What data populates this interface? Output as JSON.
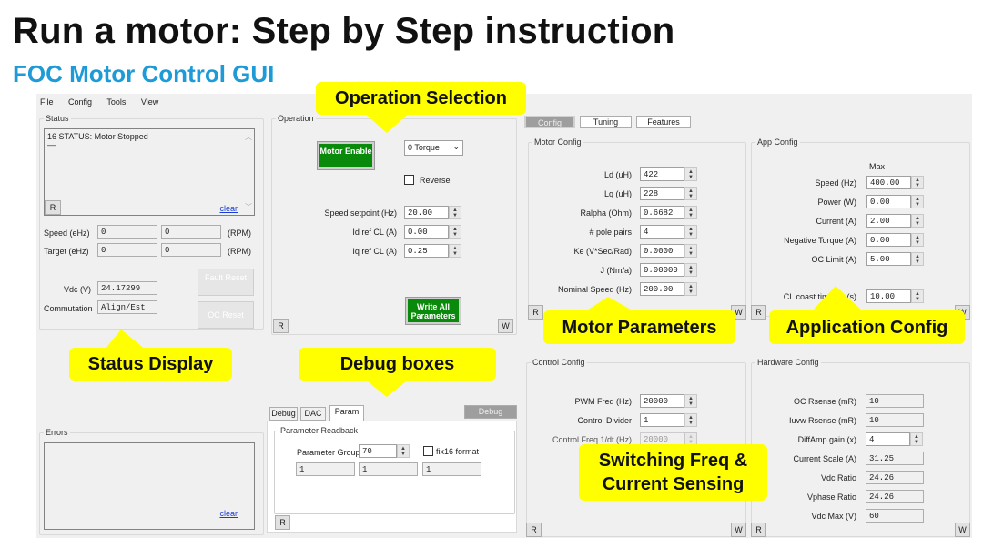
{
  "title": "Run a motor: Step by Step instruction",
  "subtitle": "FOC Motor Control GUI",
  "menu": [
    "File",
    "Config",
    "Tools",
    "View"
  ],
  "status": {
    "group": "Status",
    "log": "16 STATUS: Motor Stopped",
    "log2": "—",
    "clear": "clear",
    "r": "R",
    "speed_label": "Speed (eHz)",
    "speed_ehz": "0",
    "speed_rpm": "0",
    "target_label": "Target (eHz)",
    "target_ehz": "0",
    "target_rpm": "0",
    "rpm": "(RPM)",
    "vdc_label": "Vdc (V)",
    "vdc": "24.17299",
    "commutation_label": "Commutation",
    "commutation": "Align/Est",
    "fault_reset": "Fault Reset",
    "oc_reset": "OC Reset"
  },
  "errors": {
    "group": "Errors",
    "clear": "clear"
  },
  "operation": {
    "group": "Operation",
    "motor_enable": "Motor Enable",
    "mode": "0 Torque",
    "reverse": "Reverse",
    "reverse_checked": false,
    "fields": [
      {
        "label": "Speed setpoint (Hz)",
        "value": "20.00"
      },
      {
        "label": "Id ref CL (A)",
        "value": "0.00"
      },
      {
        "label": "Iq ref CL (A)",
        "value": "0.25"
      }
    ],
    "write_all": "Write All Parameters",
    "r": "R",
    "w": "W"
  },
  "debug": {
    "tabs": [
      "Debug",
      "DAC",
      "Param"
    ],
    "active_tab": "Param",
    "button": "Debug",
    "group": "Parameter Readback",
    "param_group_label": "Parameter Group",
    "param_group": "70",
    "fix16": "fix16 format",
    "readback": [
      "1",
      "1",
      "1"
    ],
    "r": "R"
  },
  "config_tabs": [
    "Config",
    "Tuning",
    "Features"
  ],
  "active_config_tab": "Config",
  "motor_config": {
    "group": "Motor Config",
    "fields": [
      {
        "label": "Ld (uH)",
        "value": "422"
      },
      {
        "label": "Lq (uH)",
        "value": "228"
      },
      {
        "label": "Ralpha (Ohm)",
        "value": "0.6682"
      },
      {
        "label": "# pole pairs",
        "value": "4"
      },
      {
        "label": "Ke (V*Sec/Rad)",
        "value": "0.0000"
      },
      {
        "label": "J (Nm/a)",
        "value": "0.00000"
      },
      {
        "label": "Nominal Speed (Hz)",
        "value": "200.00"
      }
    ],
    "r": "R",
    "w": "W"
  },
  "app_config": {
    "group": "App Config",
    "max": "Max",
    "fields": [
      {
        "label": "Speed (Hz)",
        "value": "400.00"
      },
      {
        "label": "Power (W)",
        "value": "0.00"
      },
      {
        "label": "Current (A)",
        "value": "2.00"
      },
      {
        "label": "Negative Torque (A)",
        "value": "0.00"
      },
      {
        "label": "OC Limit (A)",
        "value": "5.00"
      },
      {
        "label": "CL coast timeout (s)",
        "value": "10.00"
      }
    ],
    "r": "R",
    "w": "W"
  },
  "control_config": {
    "group": "Control Config",
    "fields": [
      {
        "label": "PWM Freq (Hz)",
        "value": "20000"
      },
      {
        "label": "Control Divider",
        "value": "1"
      },
      {
        "label": "Control Freq 1/dt (Hz)",
        "value": "20000",
        "disabled": true
      }
    ],
    "r": "R",
    "w": "W"
  },
  "hardware_config": {
    "group": "Hardware Config",
    "fields": [
      {
        "label": "OC Rsense (mR)",
        "value": "10"
      },
      {
        "label": "Iuvw Rsense (mR)",
        "value": "10"
      },
      {
        "label": "DiffAmp gain (x)",
        "value": "4",
        "editable": true
      },
      {
        "label": "Current Scale (A)",
        "value": "31.25"
      },
      {
        "label": "Vdc Ratio",
        "value": "24.26"
      },
      {
        "label": "Vphase Ratio",
        "value": "24.26"
      },
      {
        "label": "Vdc Max (V)",
        "value": "60"
      }
    ],
    "r": "R",
    "w": "W"
  },
  "callouts": {
    "operation": "Operation Selection",
    "motor": "Motor Parameters",
    "app": "Application Config",
    "status": "Status Display",
    "debug": "Debug boxes",
    "switching": "Switching Freq & Current Sensing"
  },
  "colors": {
    "accent": "#1e9bd7",
    "callout": "#ffff00",
    "enable_button": "#0a8a0a"
  }
}
